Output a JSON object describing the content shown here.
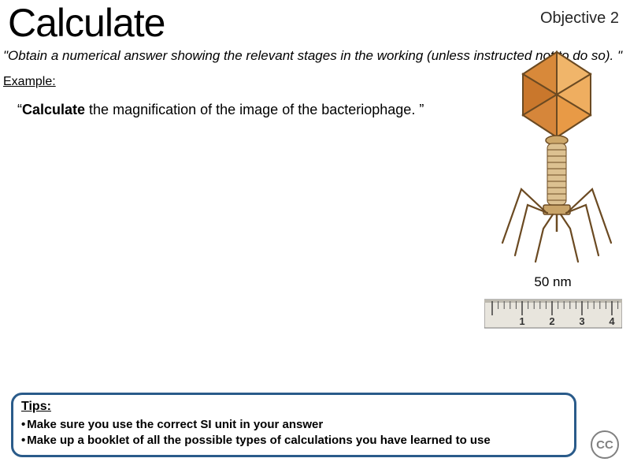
{
  "header": {
    "title": "Calculate",
    "objective": "Objective 2"
  },
  "definition": "\"Obtain a numerical answer showing the relevant stages in the working (unless instructed not to do so). \"",
  "example": {
    "label": "Example:",
    "prefix": "“",
    "bold_word": "Calculate",
    "rest": " the magnification of the image of the bacteriophage. ”"
  },
  "scale_label": "50 nm",
  "ruler_numbers": [
    "1",
    "2",
    "3",
    "4"
  ],
  "tips": {
    "title": "Tips:",
    "items": [
      "Make sure you use the correct SI unit in your answer",
      "Make up a booklet of all the possible types of calculations you have learned to use"
    ]
  },
  "cc_label": "CC",
  "image": {
    "name": "bacteriophage-illustration"
  }
}
